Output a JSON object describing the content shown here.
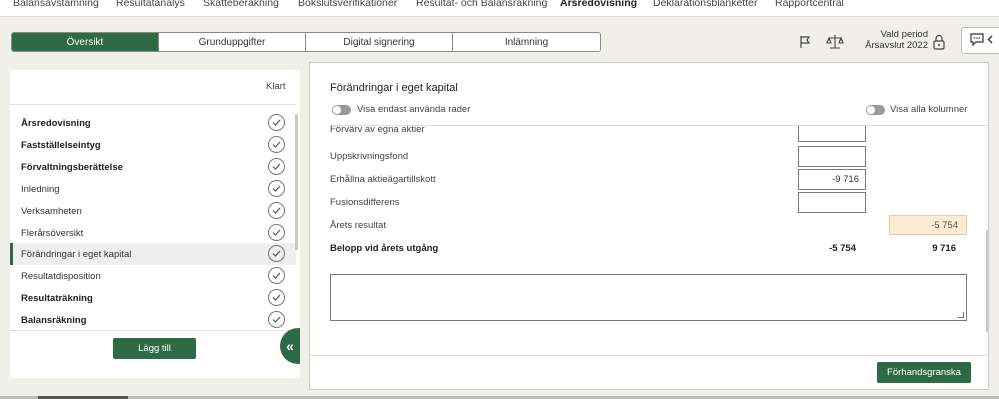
{
  "topnav": {
    "items": [
      "Balansavstämning",
      "Resultatanalys",
      "Skatteberäkning",
      "Bokslutsverifikationer",
      "Resultat- och Balansräkning",
      "Årsredovisning",
      "Deklarationsblanketter",
      "Rapportcentral"
    ],
    "active": "Årsredovisning"
  },
  "tabs": [
    "Översikt",
    "Grunduppgifter",
    "Digital signering",
    "Inlämning"
  ],
  "header": {
    "period_label": "Vald period",
    "period_value": "Årsavslut 2022",
    "icons": [
      "flag-icon",
      "balance-scale-icon",
      "lock-icon",
      "chat-icon",
      "chevron-left-icon"
    ]
  },
  "sidebar": {
    "klart_label": "Klart",
    "items": [
      {
        "label": "Årsredovisning",
        "bold": true
      },
      {
        "label": "Fastställelseintyg",
        "bold": true
      },
      {
        "label": "Förvaltningsberättelse",
        "bold": true
      },
      {
        "label": "Inledning",
        "bold": false
      },
      {
        "label": "Verksamheten",
        "bold": false
      },
      {
        "label": "Flerårsöversikt",
        "bold": false
      },
      {
        "label": "Förändringar i eget kapital",
        "bold": false,
        "selected": true
      },
      {
        "label": "Resultatdisposition",
        "bold": false
      },
      {
        "label": "Resultaträkning",
        "bold": true
      },
      {
        "label": "Balansräkning",
        "bold": true
      }
    ],
    "add_button": "Lägg till"
  },
  "main": {
    "title": "Förändringar i eget kapital",
    "toggle_used_rows": "Visa endast använda rader",
    "toggle_all_columns": "Visa alla kolumner",
    "rows": [
      {
        "label": "Förvärv av egna aktier",
        "value": ""
      },
      {
        "label": "Uppskrivningsfond",
        "value": ""
      },
      {
        "label": "Erhållna aktieägartillskott",
        "value": "-9 716"
      },
      {
        "label": "Fusionsdifferens",
        "value": ""
      }
    ],
    "arets_resultat_label": "Årets resultat",
    "arets_resultat_value": "-5 754",
    "total_label": "Belopp vid årets utgång",
    "total_col1": "-5 754",
    "total_col2": "9 716",
    "preview_button": "Förhandsgranska"
  },
  "colors": {
    "accent": "#2e6b45",
    "highlight": "#fbecd3",
    "background": "#f0efea"
  }
}
